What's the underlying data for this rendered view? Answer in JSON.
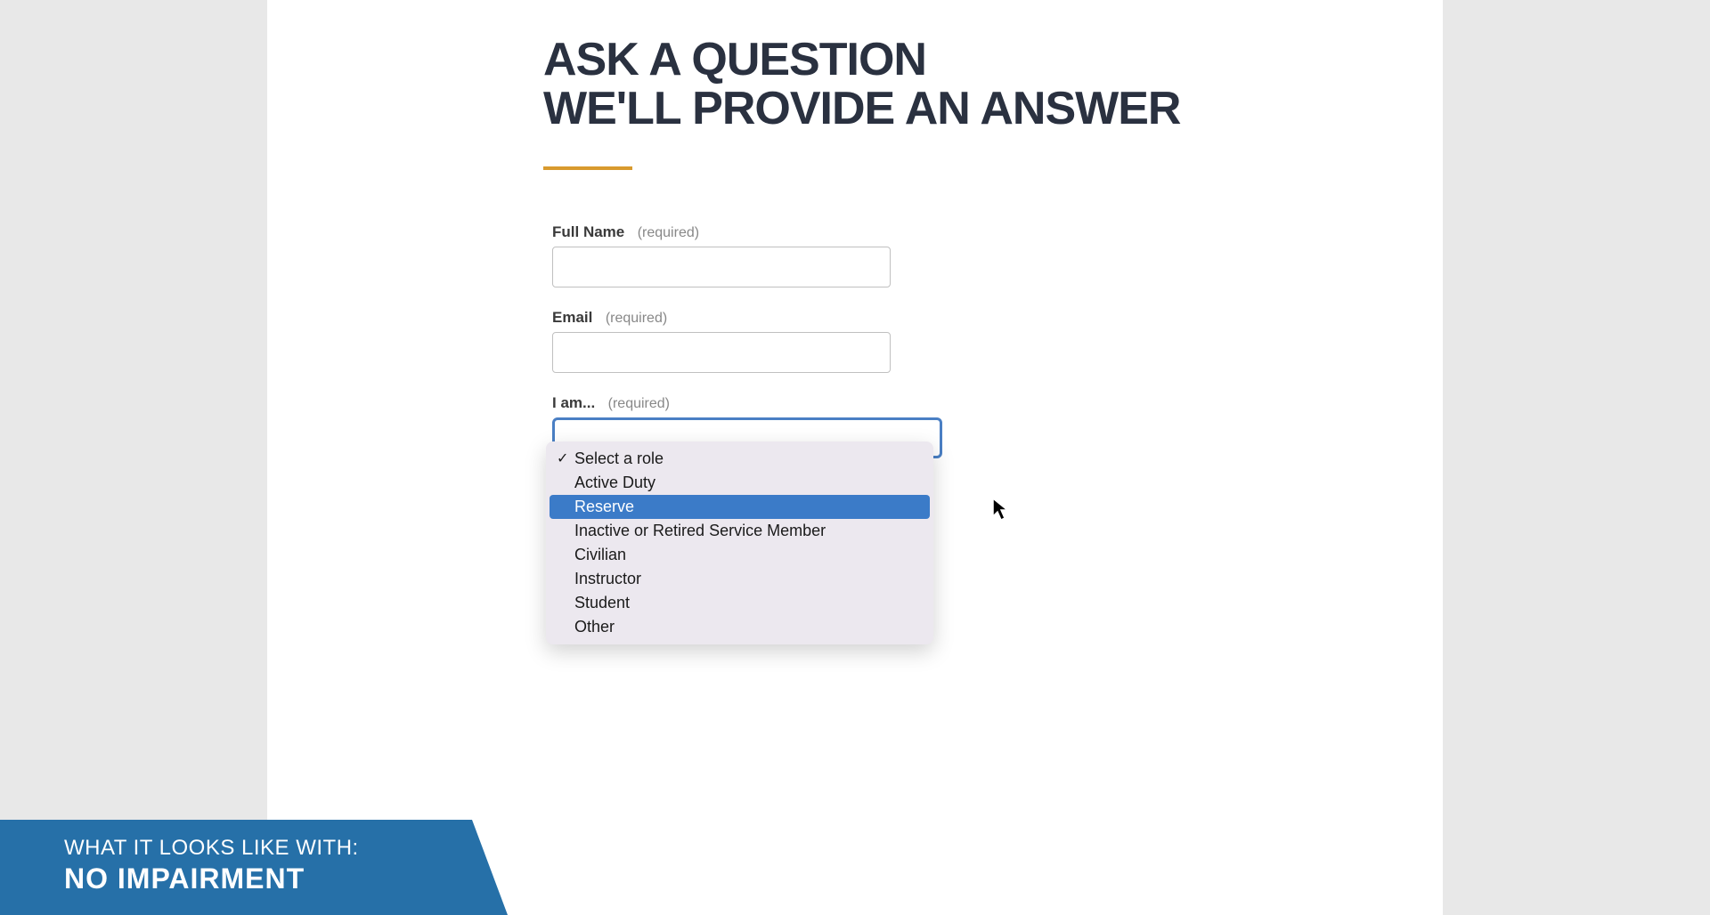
{
  "heading": {
    "line1": "ASK A QUESTION",
    "line2": "WE'LL PROVIDE AN ANSWER"
  },
  "form": {
    "fullName": {
      "label": "Full Name",
      "required": "(required)",
      "value": ""
    },
    "email": {
      "label": "Email",
      "required": "(required)",
      "value": ""
    },
    "role": {
      "label": "I am...",
      "required": "(required)",
      "options": [
        "Select a role",
        "Active Duty",
        "Reserve",
        "Inactive or Retired Service Member",
        "Civilian",
        "Instructor",
        "Student",
        "Other"
      ],
      "checkedIndex": 0,
      "highlightedIndex": 2
    }
  },
  "banner": {
    "line1": "WHAT IT LOOKS LIKE WITH:",
    "line2": "NO IMPAIRMENT"
  }
}
